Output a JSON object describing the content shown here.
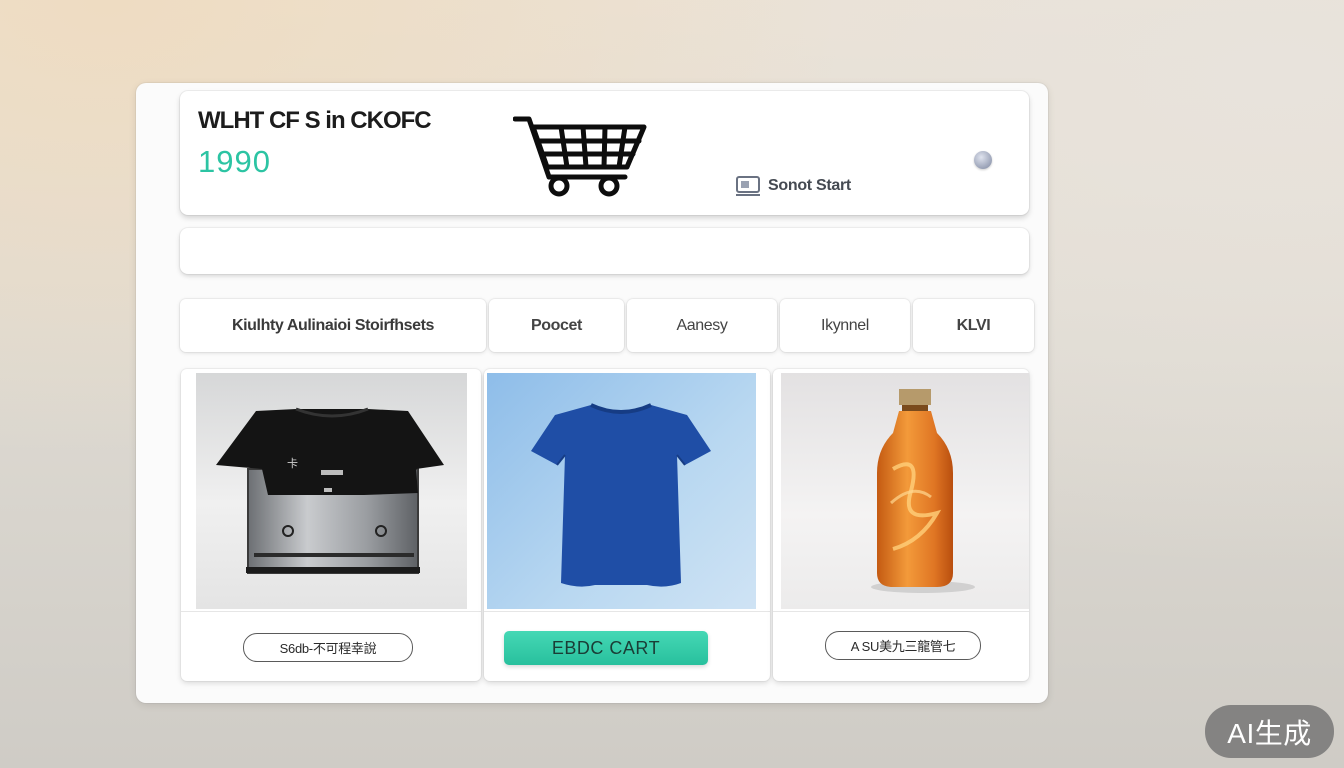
{
  "header": {
    "store_title": "WLHT CF S   in CKOFC",
    "store_number": "1990",
    "status_label": "Sonot Start"
  },
  "search": {
    "placeholder": ""
  },
  "tabs": [
    {
      "label": "Kiulhty  Aulinaioi  Stoirfhsets"
    },
    {
      "label": "Poocet"
    },
    {
      "label": "Aanesy"
    },
    {
      "label": "Ikynnel"
    },
    {
      "label": "KLVI"
    }
  ],
  "products": [
    {
      "image": "black-tshirt-on-heat-press",
      "button_label": "S6db-不可程幸說"
    },
    {
      "image": "blue-tshirt",
      "button_label": "EBDC CART"
    },
    {
      "image": "orange-bottle",
      "button_label": "A SU美九三龍管七"
    }
  ],
  "watermark": "AI生成",
  "colors": {
    "accent": "#2cc4a3",
    "cart_button": "#36cba8",
    "card_bg": "#fbfbfb",
    "blue_panel": "#a9cdee"
  }
}
